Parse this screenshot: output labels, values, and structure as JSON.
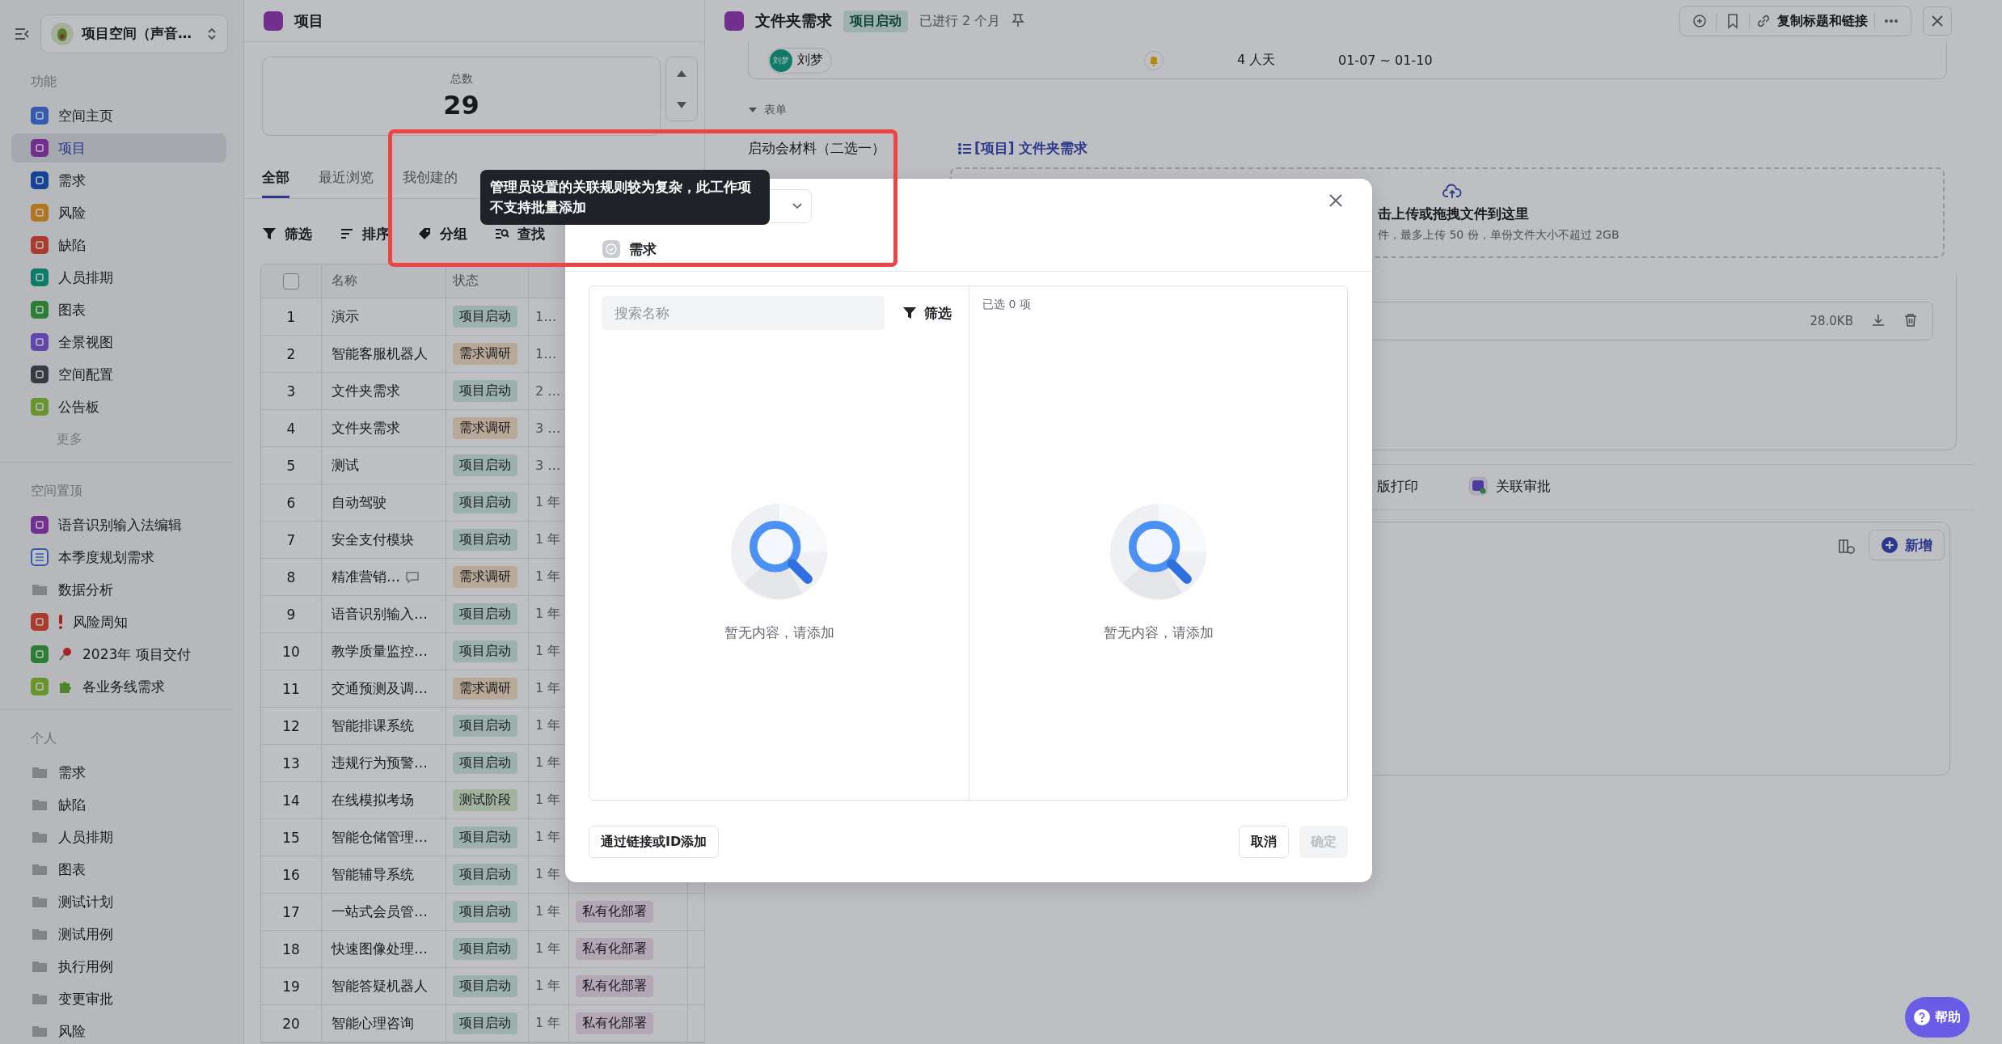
{
  "sidebar": {
    "space_name": "项目空间（声音…",
    "features": {
      "title": "功能",
      "more": "更多",
      "items": [
        {
          "label": "空间主页",
          "color": "#375bac",
          "selected": false
        },
        {
          "label": "项目",
          "color": "#732f8d",
          "selected": true
        },
        {
          "label": "需求",
          "color": "#154395",
          "selected": false
        },
        {
          "label": "风险",
          "color": "#b07622",
          "selected": false
        },
        {
          "label": "缺陷",
          "color": "#a93b2f",
          "selected": false
        },
        {
          "label": "人员排期",
          "color": "#0d7b68",
          "selected": false
        },
        {
          "label": "图表",
          "color": "#2d7e35",
          "selected": false
        },
        {
          "label": "全景视图",
          "color": "#6247aa",
          "selected": false
        },
        {
          "label": "空间配置",
          "color": "#383b42",
          "selected": false
        },
        {
          "label": "公告板",
          "color": "#6a942f",
          "selected": false
        }
      ]
    },
    "pinned": {
      "title": "空间置顶",
      "items": [
        {
          "label": "语音识别输入法编辑",
          "kind": "square",
          "color": "#732f8d",
          "selected": false
        },
        {
          "label": "本季度规划需求",
          "kind": "outline",
          "color": "#375bac",
          "selected": false
        },
        {
          "label": "数据分析",
          "kind": "folder",
          "selected": false
        },
        {
          "label": "风险周知",
          "kind": "square-alert",
          "color": "#a93b2f",
          "selected": false
        },
        {
          "label": "2023年 项目交付",
          "kind": "square-pin",
          "color": "#2d7e35",
          "selected": false
        },
        {
          "label": "各业务线需求",
          "kind": "square-puzzle",
          "color": "#6a942f",
          "selected": false
        }
      ]
    },
    "personal": {
      "title": "个人",
      "items": [
        {
          "label": "需求",
          "kind": "folder",
          "selected": false
        },
        {
          "label": "缺陷",
          "kind": "folder",
          "selected": false
        },
        {
          "label": "人员排期",
          "kind": "folder",
          "selected": false
        },
        {
          "label": "图表",
          "kind": "folder",
          "selected": false
        },
        {
          "label": "测试计划",
          "kind": "folder",
          "selected": false
        },
        {
          "label": "测试用例",
          "kind": "folder",
          "selected": false
        },
        {
          "label": "执行用例",
          "kind": "folder",
          "selected": false
        },
        {
          "label": "变更审批",
          "kind": "folder",
          "selected": false
        },
        {
          "label": "风险",
          "kind": "folder",
          "selected": false
        }
      ]
    }
  },
  "project_list": {
    "title": "项目",
    "stat": {
      "label": "总数",
      "value": "29"
    },
    "tabs": [
      {
        "label": "全部",
        "selected": true
      },
      {
        "label": "最近浏览",
        "selected": false
      },
      {
        "label": "我创建的",
        "selected": false
      }
    ],
    "toolbar": [
      "筛选",
      "排序",
      "分组",
      "查找"
    ],
    "table": {
      "header_checked": false,
      "columns": [
        "名称",
        "状态"
      ],
      "rows": [
        {
          "index": "1",
          "name": "演示",
          "comment": false,
          "status": {
            "text": "项目启动",
            "color": "#9cb1ac"
          },
          "column_4": "1…"
        },
        {
          "index": "2",
          "name": "智能客服机器人",
          "comment": false,
          "status": {
            "text": "需求调研",
            "color": "#b7a897"
          },
          "column_4": "1…"
        },
        {
          "index": "3",
          "name": "文件夹需求",
          "comment": false,
          "status": {
            "text": "项目启动",
            "color": "#9cb1ac"
          },
          "column_4": "2 …"
        },
        {
          "index": "4",
          "name": "文件夹需求",
          "comment": false,
          "status": {
            "text": "需求调研",
            "color": "#b7a897"
          },
          "column_4": "3 …"
        },
        {
          "index": "5",
          "name": "测试",
          "comment": false,
          "status": {
            "text": "项目启动",
            "color": "#9cb1ac"
          },
          "column_4": "3 …"
        },
        {
          "index": "6",
          "name": "自动驾驶",
          "comment": false,
          "status": {
            "text": "项目启动",
            "color": "#9cb1ac"
          },
          "column_4": "1 年"
        },
        {
          "index": "7",
          "name": "安全支付模块",
          "comment": false,
          "status": {
            "text": "项目启动",
            "color": "#9cb1ac"
          },
          "column_4": "1 年"
        },
        {
          "index": "8",
          "name": "精准营销…",
          "comment": true,
          "status": {
            "text": "需求调研",
            "color": "#b7a897"
          },
          "column_4": "1 年"
        },
        {
          "index": "9",
          "name": "语音识别输入…",
          "comment": false,
          "status": {
            "text": "项目启动",
            "color": "#9cb1ac"
          },
          "column_4": "1 年"
        },
        {
          "index": "10",
          "name": "教学质量监控…",
          "comment": false,
          "status": {
            "text": "项目启动",
            "color": "#9cb1ac"
          },
          "column_4": "1 年"
        },
        {
          "index": "11",
          "name": "交通预测及调…",
          "comment": false,
          "status": {
            "text": "需求调研",
            "color": "#b7a897"
          },
          "column_4": "1 年"
        },
        {
          "index": "12",
          "name": "智能排课系统",
          "comment": false,
          "status": {
            "text": "项目启动",
            "color": "#9cb1ac"
          },
          "column_4": "1 年"
        },
        {
          "index": "13",
          "name": "违规行为预警…",
          "comment": false,
          "status": {
            "text": "项目启动",
            "color": "#9cb1ac"
          },
          "column_4": "1 年"
        },
        {
          "index": "14",
          "name": "在线模拟考场",
          "comment": false,
          "status": {
            "text": "测试阶段",
            "color": "#a3b29e"
          },
          "column_4": "1 年"
        },
        {
          "index": "15",
          "name": "智能仓储管理…",
          "comment": false,
          "status": {
            "text": "项目启动",
            "color": "#9cb1ac"
          },
          "column_4": "1 年"
        },
        {
          "index": "16",
          "name": "智能辅导系统",
          "comment": false,
          "status": {
            "text": "项目启动",
            "color": "#9cb1ac"
          },
          "column_4": "1 年"
        },
        {
          "index": "17",
          "name": "一站式会员管…",
          "comment": false,
          "status": {
            "text": "项目启动",
            "color": "#9cb1ac"
          },
          "column_4": "1 年",
          "column_5": {
            "text": "私有化部署",
            "color": "#b3a7b6"
          }
        },
        {
          "index": "18",
          "name": "快速图像处理…",
          "comment": false,
          "status": {
            "text": "项目启动",
            "color": "#9cb1ac"
          },
          "column_4": "1 年",
          "column_5": {
            "text": "私有化部署",
            "color": "#b3a7b6"
          }
        },
        {
          "index": "19",
          "name": "智能答疑机器人",
          "comment": false,
          "status": {
            "text": "项目启动",
            "color": "#9cb1ac"
          },
          "column_4": "1 年",
          "column_5": {
            "text": "私有化部署",
            "color": "#b3a7b6"
          }
        },
        {
          "index": "20",
          "name": "智能心理咨询",
          "comment": false,
          "status": {
            "text": "项目启动",
            "color": "#9cb1ac"
          },
          "column_4": "1 年",
          "column_5": {
            "text": "私有化部署",
            "color": "#b3a7b6"
          }
        }
      ]
    }
  },
  "detail": {
    "title": "文件夹需求",
    "status": "项目启动",
    "elapsed": "已进行 2 个月",
    "copy_link": "复制标题和链接",
    "schedule": {
      "avatar": "刘梦",
      "person": "刘梦",
      "effort": "4 人天",
      "dates": "01-07 ~ 01-10"
    },
    "section": {
      "title": "表单",
      "expanded": true
    },
    "field": {
      "label": "启动会材料（二选一）",
      "link": "[项目] 文件夹需求"
    },
    "upload": {
      "hint": "击上传或拖拽文件到这里",
      "limits": "件，最多上传 50 份，单份文件大小不超过 2GB"
    },
    "file": {
      "size": "28.0KB"
    },
    "tabs": [
      {
        "label": "版打印",
        "selected": false
      },
      {
        "label": "关联审批",
        "selected": false
      }
    ],
    "add_button": "新增"
  },
  "modal": {
    "option": "需求",
    "search": {
      "placeholder": "搜索名称"
    },
    "filter": "筛选",
    "selected_count": "已选 0 项",
    "empty_left": "暂无内容，请添加",
    "empty_right": "暂无内容，请添加",
    "link_button": "通过链接或ID添加",
    "cancel": "取消",
    "confirm": {
      "label": "确定",
      "disabled": true
    }
  },
  "tooltip": "管理员设置的关联规则较为复杂，此工作项不支持批量添加",
  "help": "帮助"
}
